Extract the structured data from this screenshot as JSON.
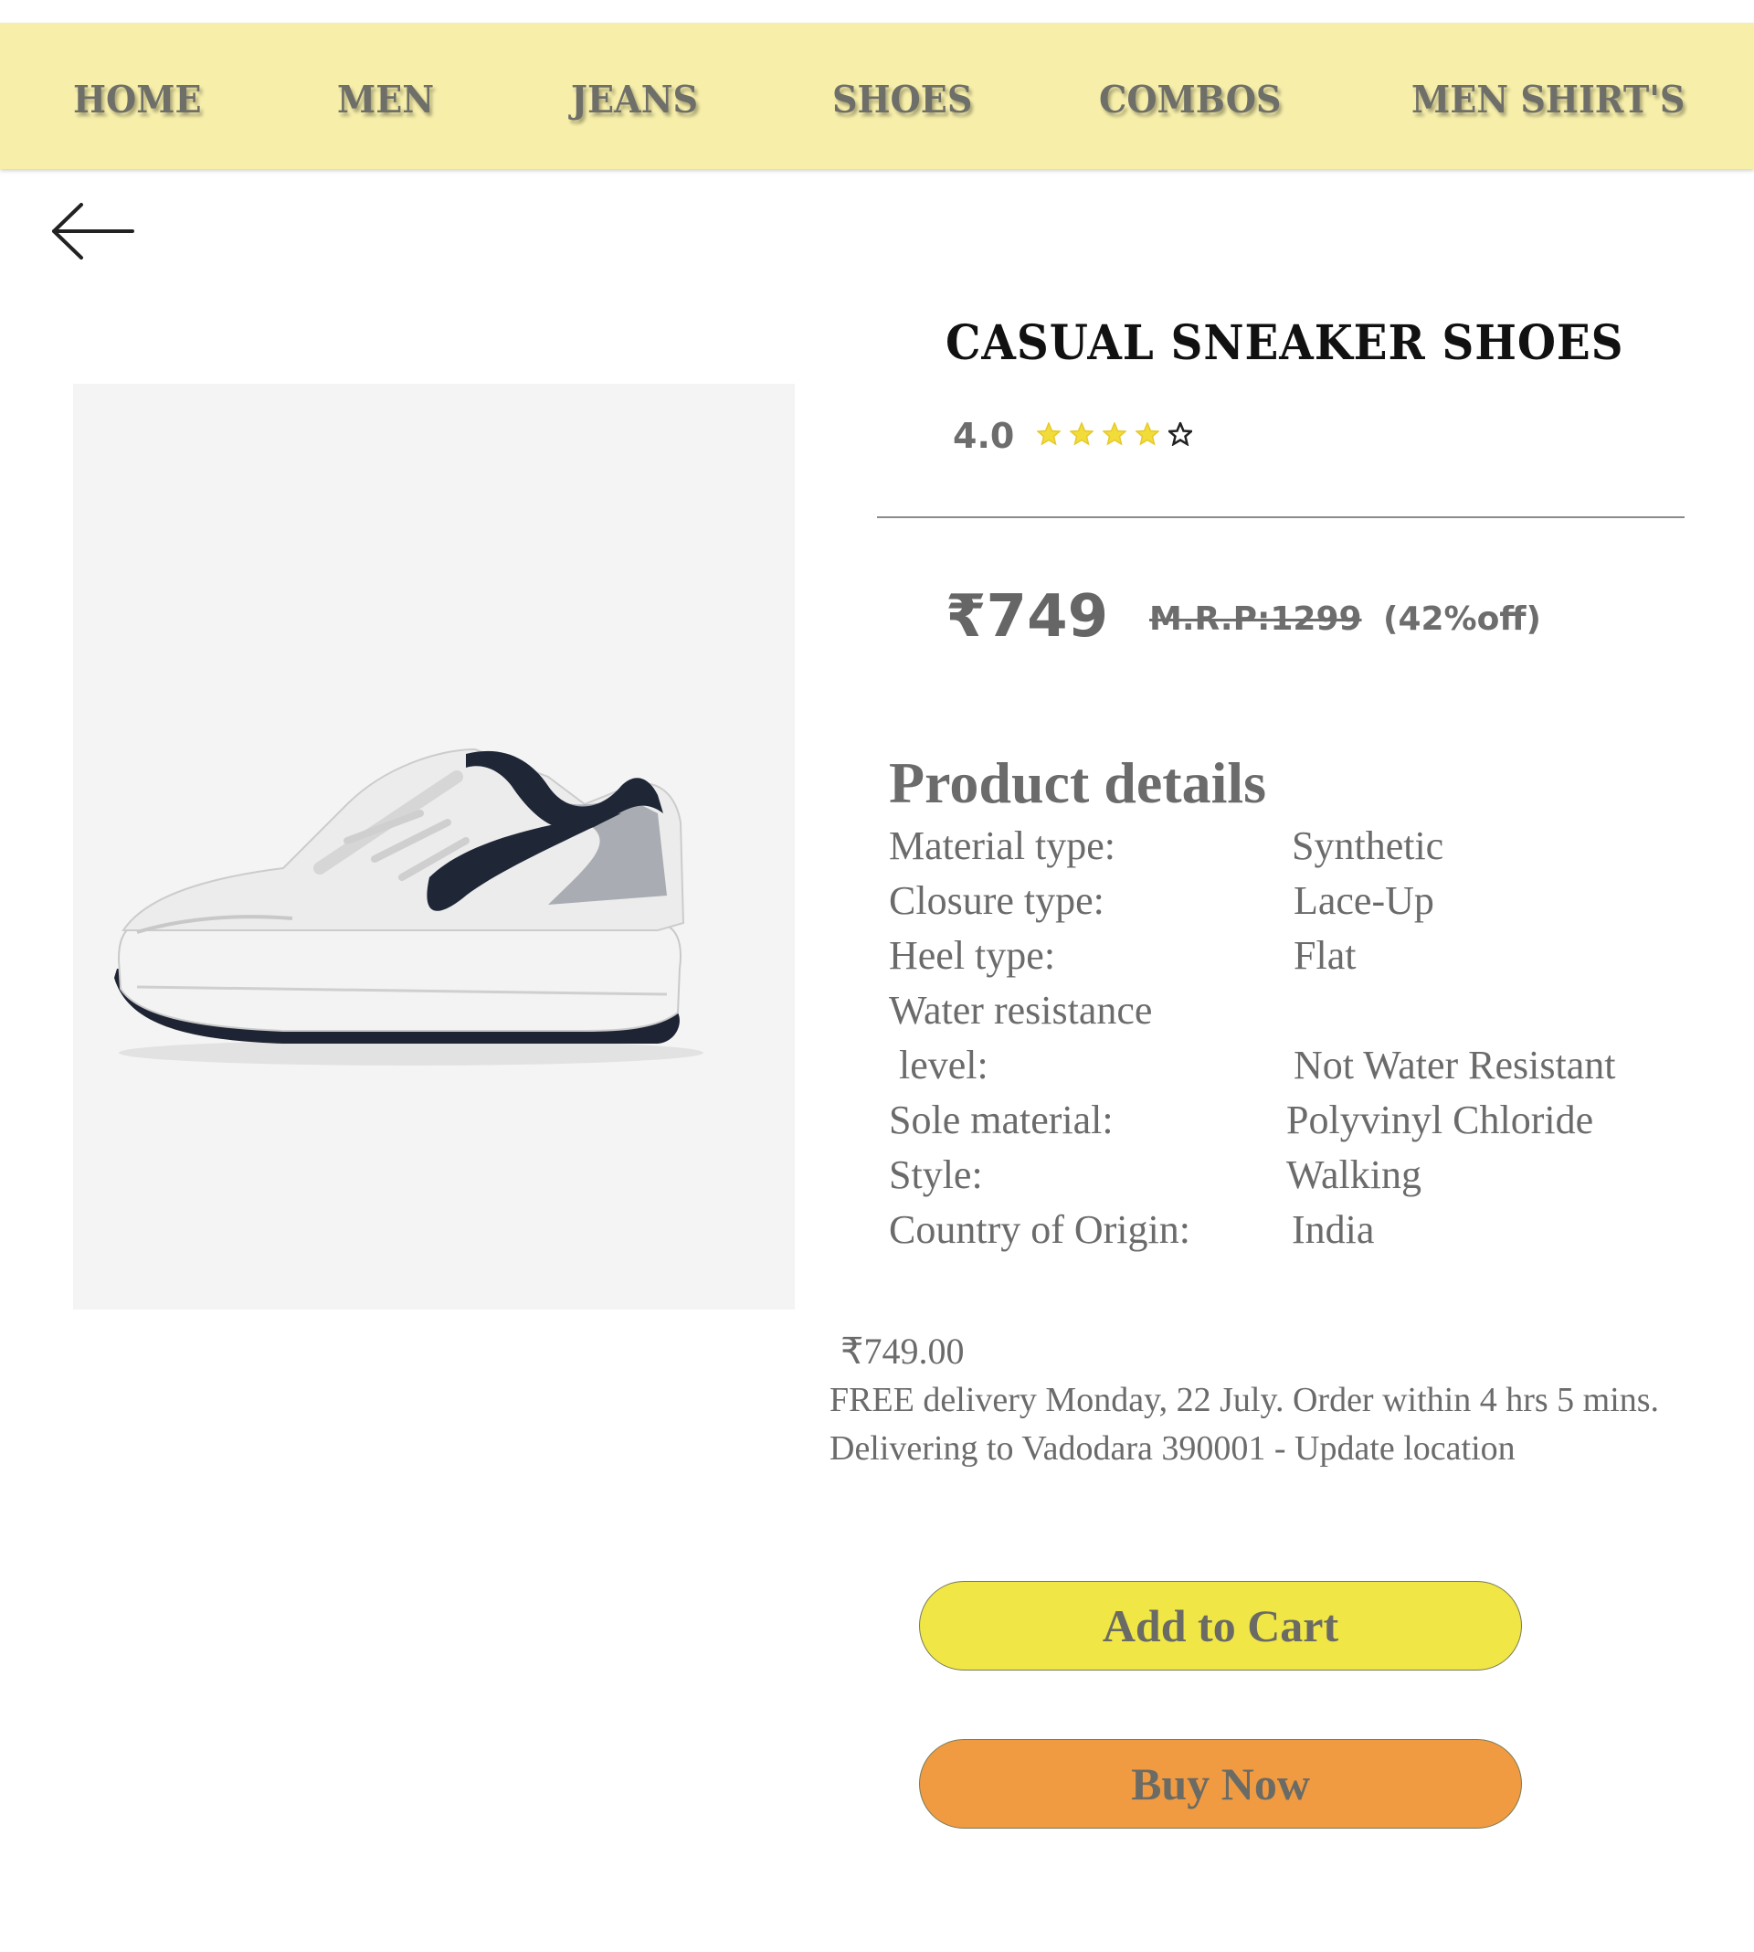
{
  "nav": {
    "items": [
      {
        "label": "HOME"
      },
      {
        "label": "MEN"
      },
      {
        "label": "JEANS"
      },
      {
        "label": "SHOES"
      },
      {
        "label": "COMBOS"
      },
      {
        "label": "MEN SHIRT'S"
      }
    ]
  },
  "back": {
    "icon": "arrow-left-icon"
  },
  "product": {
    "title": "CASUAL SNEAKER SHOES",
    "rating": "4.0",
    "rating_value": 4.0,
    "rating_max": 5,
    "price": "₹749",
    "mrp": "M.R.P:1299",
    "discount": "(42%off)"
  },
  "details": {
    "heading": "Product details",
    "rows": [
      {
        "label": "Material type:",
        "value": "Synthetic"
      },
      {
        "label": "Closure type:",
        "value": "Lace-Up"
      },
      {
        "label": "Heel type:",
        "value": "Flat"
      },
      {
        "label": "Water resistance",
        "label2": " level:",
        "value": "Not Water Resistant"
      },
      {
        "label": "Sole material:",
        "value": "Polyvinyl Chloride"
      },
      {
        "label": "Style:",
        "value": "Walking"
      },
      {
        "label": "Country of Origin:",
        "value": "India"
      }
    ]
  },
  "delivery": {
    "price": "₹749.00",
    "line1": "FREE delivery Monday, 22 July. Order within 4 hrs 5 mins.",
    "line2": "Delivering to Vadodara 390001 - Update location"
  },
  "actions": {
    "add_to_cart": "Add to Cart",
    "buy_now": "Buy Now"
  },
  "colors": {
    "nav_bg": "#f6eea9",
    "star_filled": "#f2dc3a",
    "add_to_cart_bg": "#f0e645",
    "buy_now_bg": "#f09b42"
  }
}
